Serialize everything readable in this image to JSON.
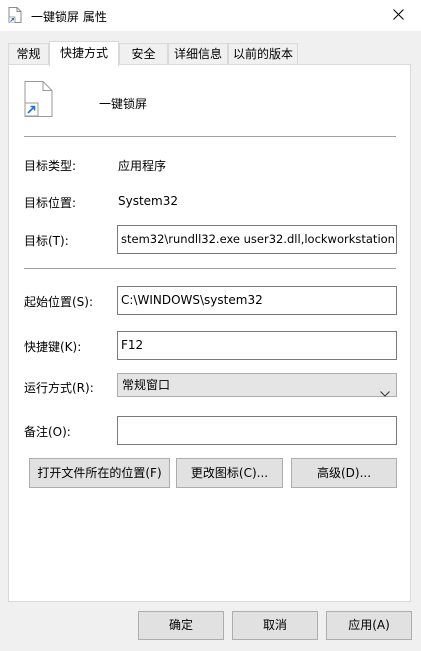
{
  "window": {
    "title": "一键锁屏 属性"
  },
  "tabs": [
    {
      "label": "常规"
    },
    {
      "label": "快捷方式"
    },
    {
      "label": "安全"
    },
    {
      "label": "详细信息"
    },
    {
      "label": "以前的版本"
    }
  ],
  "shortcut": {
    "name": "一键锁屏",
    "target_type_label": "目标类型:",
    "target_type_value": "应用程序",
    "target_location_label": "目标位置:",
    "target_location_value": "System32",
    "target_label": "目标(T):",
    "target_value": "stem32\\rundll32.exe user32.dll,lockworkstation",
    "start_in_label": "起始位置(S):",
    "start_in_value": "C:\\WINDOWS\\system32",
    "hotkey_label": "快捷键(K):",
    "hotkey_value": "F12",
    "run_label": "运行方式(R):",
    "run_value": "常规窗口",
    "comment_label": "备注(O):",
    "comment_value": ""
  },
  "buttons": {
    "open_location": "打开文件所在的位置(F)",
    "change_icon": "更改图标(C)...",
    "advanced": "高级(D)..."
  },
  "footer": {
    "ok": "确定",
    "cancel": "取消",
    "apply": "应用(A)"
  },
  "colors": {
    "window_bg": "#f0f0f0",
    "panel_bg": "#ffffff",
    "button_bg": "#e1e1e1",
    "icon_blue": "#1e73d2"
  },
  "icons": {
    "title": "shortcut-file-icon",
    "close": "close-icon",
    "large": "shortcut-file-icon",
    "dropdown": "chevron-down-icon"
  }
}
